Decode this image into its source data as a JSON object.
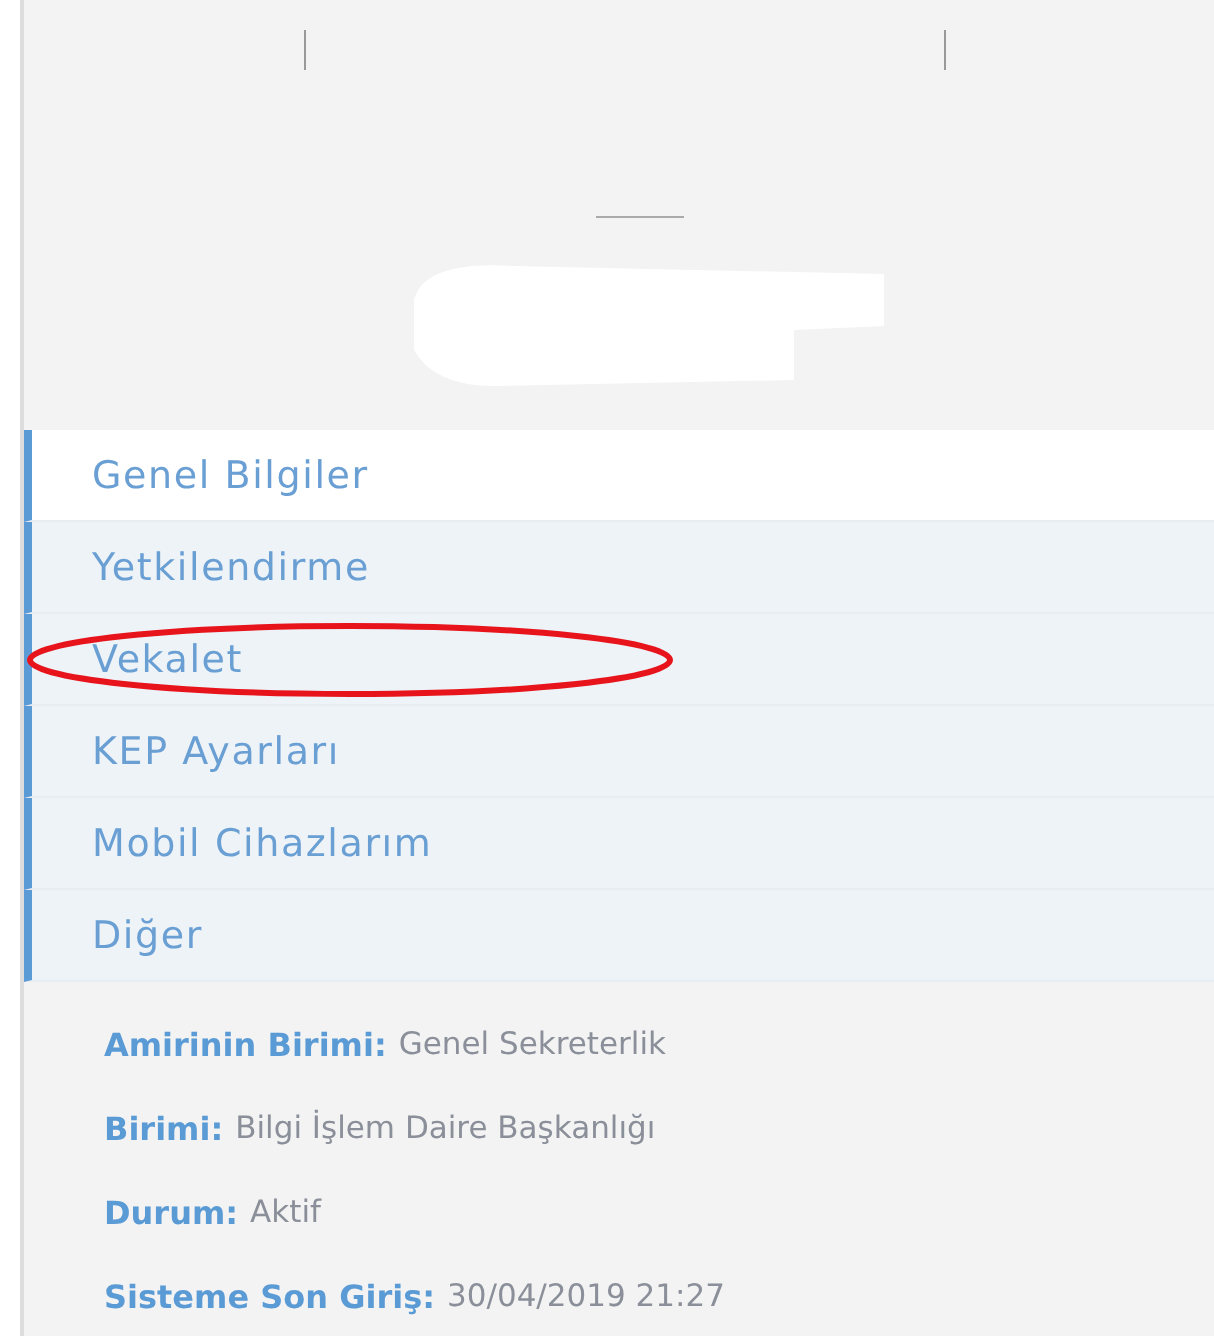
{
  "menu": [
    {
      "label": "Genel Bilgiler",
      "selected": true,
      "circled": false
    },
    {
      "label": "Yetkilendirme",
      "selected": false,
      "circled": false
    },
    {
      "label": "Vekalet",
      "selected": false,
      "circled": true
    },
    {
      "label": "KEP Ayarları",
      "selected": false,
      "circled": false
    },
    {
      "label": "Mobil Cihazlarım",
      "selected": false,
      "circled": false
    },
    {
      "label": "Diğer",
      "selected": false,
      "circled": false
    }
  ],
  "details": [
    {
      "label": "Amirinin Birimi:",
      "value": "Genel Sekreterlik"
    },
    {
      "label": "Birimi:",
      "value": "Bilgi İşlem Daire Başkanlığı"
    },
    {
      "label": "Durum:",
      "value": "Aktif"
    },
    {
      "label": "Sisteme Son Giriş:",
      "value": "30/04/2019 21:27"
    }
  ]
}
